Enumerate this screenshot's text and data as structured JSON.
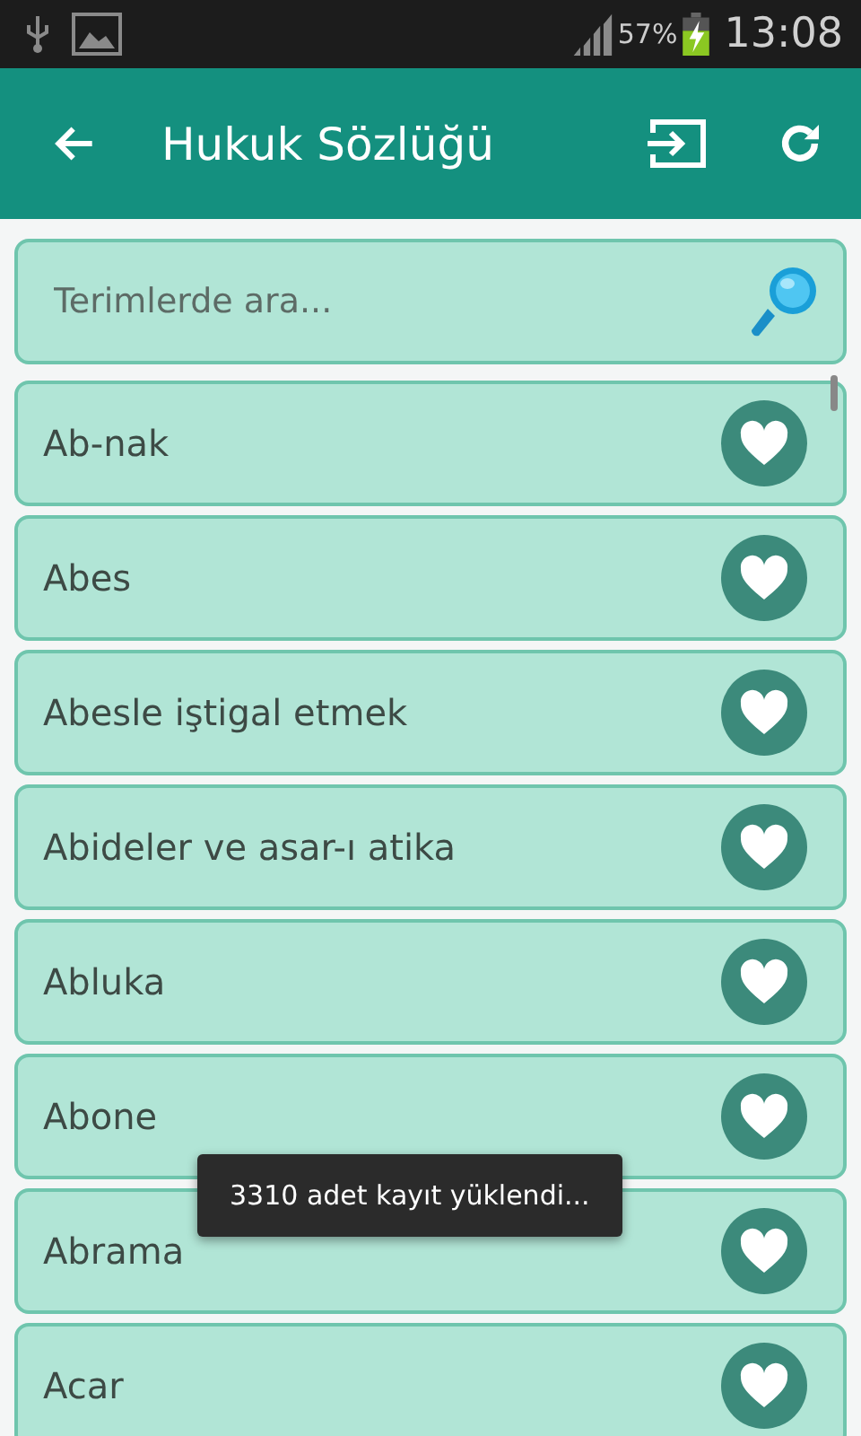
{
  "status_bar": {
    "battery": "57%",
    "time": "13:08"
  },
  "toolbar": {
    "title": "Hukuk Sözlüğü"
  },
  "search": {
    "placeholder": "Terimlerde ara..."
  },
  "terms": [
    {
      "label": "Ab-nak"
    },
    {
      "label": "Abes"
    },
    {
      "label": "Abesle iştigal etmek"
    },
    {
      "label": "Abideler ve asar-ı atika"
    },
    {
      "label": "Abluka"
    },
    {
      "label": "Abone"
    },
    {
      "label": "Abrama"
    },
    {
      "label": "Acar"
    }
  ],
  "toast": "3310 adet kayıt yüklendi..."
}
